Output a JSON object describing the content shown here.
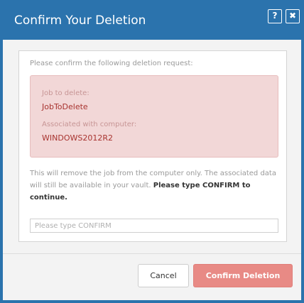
{
  "dialog": {
    "title": "Confirm Your Deletion",
    "help_label": "?",
    "close_label": "✖"
  },
  "content": {
    "intro": "Please confirm the following deletion request:",
    "job_label": "Job to delete:",
    "job_value": "JobToDelete",
    "computer_label": "Associated with computer:",
    "computer_value": "WINDOWS2012R2",
    "note_text": "This will remove the job from the computer only. The associated data will still be available in your vault.",
    "note_emphasis": "Please type CONFIRM to continue.",
    "confirm_value": "",
    "confirm_placeholder": "Please type CONFIRM"
  },
  "buttons": {
    "cancel_label": "Cancel",
    "confirm_label": "Confirm Deletion"
  },
  "colors": {
    "titlebar": "#2b73ad",
    "alert_background": "#f2d7d7",
    "alert_value": "#a8332f",
    "confirm_button": "#e88a85"
  }
}
